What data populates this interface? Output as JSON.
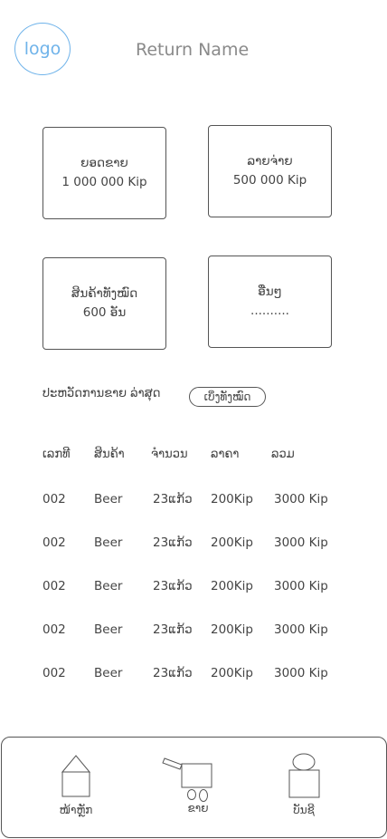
{
  "header": {
    "logo_text": "logo",
    "title": "Return Name"
  },
  "cards": [
    {
      "label": "ຍອດຂາຍ",
      "value": "1 000 000 Kip"
    },
    {
      "label": "ລາຍຈ່າຍ",
      "value": "500 000 Kip"
    },
    {
      "label": "ສິນຄ້າທັງໝົດ",
      "value": "600 ອັນ"
    },
    {
      "label": "ອື່ນໆ",
      "value": ".........."
    }
  ],
  "history": {
    "title": "ປະຫວັດການຂາຍ  ລ່າສຸດ",
    "view_all_label": "ເບິ່ງທັງໝົດ"
  },
  "table": {
    "headers": [
      "ເລກທີ",
      "ສິນຄ້າ",
      "ຈຳນວນ",
      "ລາຄາ",
      "ລວມ"
    ],
    "rows": [
      [
        "002",
        "Beer",
        "23ແກ້ວ",
        "200Kip",
        "3000 Kip"
      ],
      [
        "002",
        "Beer",
        "23ແກ້ວ",
        "200Kip",
        "3000 Kip"
      ],
      [
        "002",
        "Beer",
        "23ແກ້ວ",
        "200Kip",
        "3000 Kip"
      ],
      [
        "002",
        "Beer",
        "23ແກ້ວ",
        "200Kip",
        "3000 Kip"
      ],
      [
        "002",
        "Beer",
        "23ແກ້ວ",
        "200Kip",
        "3000 Kip"
      ]
    ]
  },
  "bottom_nav": {
    "items": [
      {
        "label": "ໜ້າຫຼັກ",
        "icon": "home-icon"
      },
      {
        "label": "ຂາຍ",
        "icon": "cart-icon"
      },
      {
        "label": "ບັນຊີ",
        "icon": "account-icon"
      }
    ]
  },
  "colors": {
    "accent": "#6fb3ea",
    "line": "#555555",
    "text": "#444444"
  }
}
